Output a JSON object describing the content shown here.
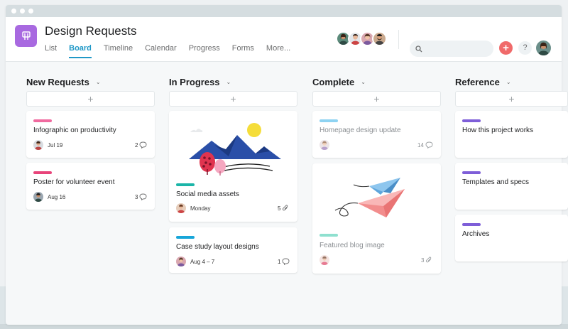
{
  "window": {
    "dots": 3
  },
  "project": {
    "title": "Design Requests",
    "icon": "clipboard-icon",
    "color": "#a869e0"
  },
  "nav": {
    "tabs": [
      "List",
      "Board",
      "Timeline",
      "Calendar",
      "Progress",
      "Forms",
      "More..."
    ],
    "active": "Board"
  },
  "header": {
    "add_button": "+",
    "help_button": "?"
  },
  "columns": [
    {
      "title": "New Requests",
      "add": "+",
      "cards": [
        {
          "title": "Infographic on productivity",
          "tag_color": "#f06a9f",
          "date": "Jul 19",
          "count": "2",
          "count_icon": "comment-icon"
        },
        {
          "title": "Poster for volunteer event",
          "tag_color": "#e8447a",
          "date": "Aug 16",
          "count": "3",
          "count_icon": "comment-icon"
        }
      ]
    },
    {
      "title": "In Progress",
      "add": "+",
      "cards": [
        {
          "title": "Social media assets",
          "tag_color": "#1bb5a8",
          "date": "Monday",
          "count": "5",
          "count_icon": "attachment-icon",
          "image": "mountains-illustration"
        },
        {
          "title": "Case study layout designs",
          "tag_color": "#17a6d9",
          "date": "Aug 4 – 7",
          "count": "1",
          "count_icon": "comment-icon"
        }
      ]
    },
    {
      "title": "Complete",
      "add": "+",
      "cards": [
        {
          "title": "Homepage design update",
          "tag_color": "#8ed3f2",
          "count": "14",
          "count_icon": "comment-icon"
        },
        {
          "title": "Featured blog image",
          "tag_color": "#8fe0cf",
          "count": "3",
          "count_icon": "attachment-icon",
          "image": "paper-planes-illustration"
        }
      ]
    },
    {
      "title": "Reference",
      "add": "+",
      "cards": [
        {
          "title": "How this project works",
          "tag_color": "#7e5ed8"
        },
        {
          "title": "Templates and specs",
          "tag_color": "#7e5ed8"
        },
        {
          "title": "Archives",
          "tag_color": "#7e5ed8"
        }
      ]
    }
  ]
}
